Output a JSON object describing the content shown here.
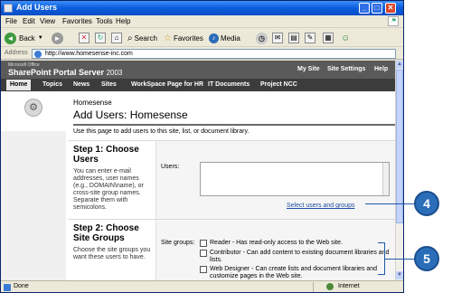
{
  "window": {
    "title": "Add Users"
  },
  "menubar": [
    "File",
    "Edit",
    "View",
    "Favorites",
    "Tools",
    "Help"
  ],
  "toolbar": {
    "back_label": "Back",
    "search_label": "Search",
    "favorites_label": "Favorites",
    "media_label": "Media"
  },
  "address": {
    "label": "Address",
    "url": "http://www.homesense-inc.com"
  },
  "sharepoint": {
    "suite_name": "Microsoft Office",
    "brand": "SharePoint Portal Server",
    "version": "2003",
    "header_links": [
      "My Site",
      "Site Settings",
      "Help"
    ],
    "nav_items": [
      "Home",
      "Topics",
      "News",
      "Sites",
      "WorkSpace Page for HR",
      "IT Documents",
      "Project NCC"
    ]
  },
  "page": {
    "site_name": "Homesense",
    "title": "Add Users: Homesense",
    "description": "Use this page to add users to this site, list, or document library."
  },
  "step1": {
    "title": "Step 1: Choose Users",
    "description": "You can enter e-mail addresses, user names (e.g., DOMAIN\\name), or cross-site group names. Separate them with semicolons.",
    "field_label": "Users:",
    "field_value": "",
    "link": "Select users and groups"
  },
  "step2": {
    "title": "Step 2: Choose Site Groups",
    "description": "Choose the site groups you want these users to have.",
    "field_label": "Site groups:",
    "groups": [
      {
        "label": "Reader - Has read-only access to the Web site.",
        "checked": false
      },
      {
        "label": "Contributor - Can add content to existing document libraries and lists.",
        "checked": false
      },
      {
        "label": "Web Designer - Can create lists and document libraries and customize pages in the Web site.",
        "checked": false
      }
    ]
  },
  "status": {
    "text": "Done",
    "zone": "Internet"
  },
  "callouts": {
    "first": "4",
    "second": "5"
  },
  "colors": {
    "titlebar": "#0a5ddc",
    "sp_header": "#5a5a5a",
    "callout": "#2a6db8"
  }
}
